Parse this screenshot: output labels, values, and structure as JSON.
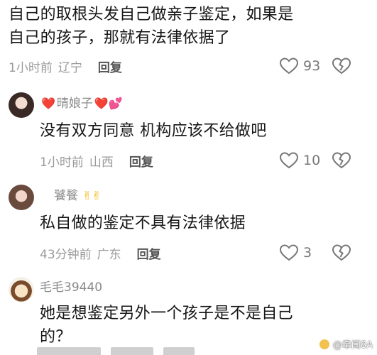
{
  "comments": [
    {
      "text_line1": "自己的取根头发自己做亲子鉴定，如果是",
      "text_line2": "自己的孩子，那就有法律依据了",
      "time": "1小时前",
      "location": "辽宁",
      "reply": "回复",
      "likes": "93"
    },
    {
      "username": "晴娘子",
      "name_prefix_emoji": "❤️",
      "name_suffix_emoji": "❤️💕",
      "text": "没有双方同意 机构应该不给做吧",
      "time": "1小时前",
      "location": "山西",
      "reply": "回复",
      "likes": "10"
    },
    {
      "username": "饕餮",
      "name_suffix_emoji": "✌✌",
      "text": "私自做的鉴定不具有法律依据",
      "time": "43分钟前",
      "location": "广东",
      "reply": "回复",
      "likes": "3"
    },
    {
      "username": "毛毛39440",
      "text_line1": "她是想鉴定另外一个孩子是不是自己",
      "text_line2": "的？"
    }
  ],
  "watermark": "@牵闹8A",
  "colors": {
    "heart_red": "#e0323c",
    "gray_text": "#9a9a9a",
    "icon_gray": "#777777"
  }
}
